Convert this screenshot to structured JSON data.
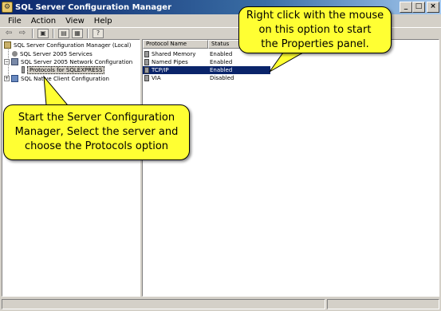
{
  "window": {
    "title": "SQL Server Configuration Manager",
    "minimize_label": "_",
    "maximize_label": "□",
    "close_label": "×"
  },
  "menu": {
    "items": [
      {
        "label": "File"
      },
      {
        "label": "Action"
      },
      {
        "label": "View"
      },
      {
        "label": "Help"
      }
    ]
  },
  "toolbar": {
    "back_icon": "back-arrow-icon",
    "forward_icon": "forward-arrow-icon",
    "up_icon": "up-folder-icon",
    "properties_icon": "properties-icon",
    "export_icon": "export-list-icon",
    "help_icon": "help-icon"
  },
  "tree": {
    "root": "SQL Server Configuration Manager (Local)",
    "services": "SQL Server 2005 Services",
    "network": "SQL Server 2005 Network Configuration",
    "protocols": "Protocols for SQLEXPRESS",
    "client": "SQL Native Client Configuration"
  },
  "list": {
    "columns": [
      "Protocol Name",
      "Status"
    ],
    "rows": [
      {
        "name": "Shared Memory",
        "status": "Enabled"
      },
      {
        "name": "Named Pipes",
        "status": "Enabled"
      },
      {
        "name": "TCP/IP",
        "status": "Enabled"
      },
      {
        "name": "VIA",
        "status": "Disabled"
      }
    ],
    "selected_index": 2
  },
  "callouts": {
    "left": "Start the Server Configuration\nManager, Select the server and\nchoose the Protocols option",
    "right": "Right click with the mouse\non this option to start\nthe Properties panel."
  },
  "colors": {
    "callout_fill": "#ffff33",
    "title_gradient_start": "#0a246a",
    "selection": "#0a246a"
  }
}
